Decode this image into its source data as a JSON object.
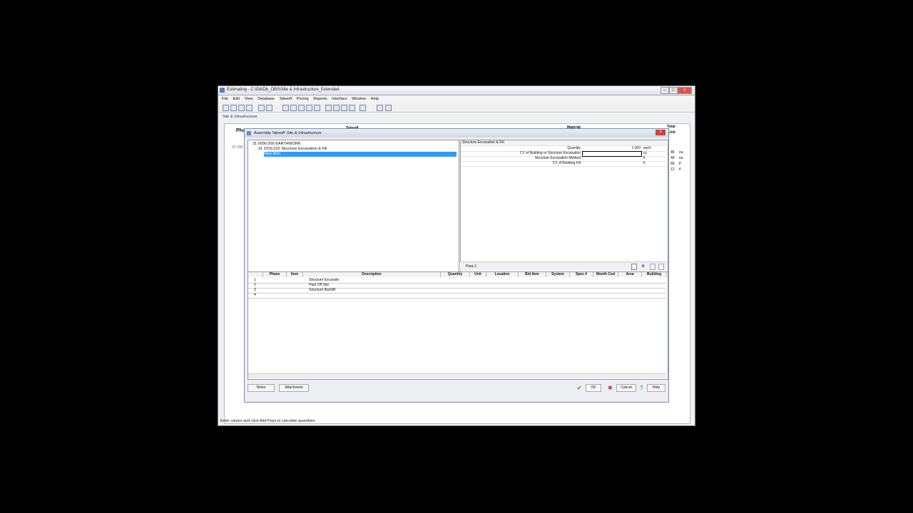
{
  "app": {
    "title": "Estimating - C:\\Db\\Db_OBS\\Site & Infrastructure_Extended",
    "menu": [
      "File",
      "Edit",
      "View",
      "Database",
      "Takeoff",
      "Pricing",
      "Reports",
      "Interface",
      "Window",
      "Help"
    ],
    "doc_tab": "Site & Infrastructure",
    "status": "Enter values and click Add Pass to calculate quantities"
  },
  "background": {
    "col_phase": "Pha",
    "takeoff": "Takeoff",
    "material": "Material",
    "total": "Total",
    "unit": "nt/Unit",
    "phase_value": "31 236",
    "side_values": [
      "48",
      "48",
      "89",
      "12"
    ],
    "side_units": [
      "ea",
      "ea",
      "if",
      "if"
    ]
  },
  "dialog": {
    "title": "Assembly Takeoff: Site & Infrastructure",
    "tree": {
      "level1": "31 0000.000  EARTHWORK",
      "level2": "31 2316.022  Structure Excavation & Fill",
      "selected": "New item"
    },
    "props": {
      "heading": "Structure Excavation & Fill",
      "rows": [
        {
          "label": "Quantity",
          "value": "1.000",
          "unit": "each"
        },
        {
          "label": "CY of Building or Structure Excavation",
          "value": "",
          "unit": "cy"
        },
        {
          "label": "Structure Excavation Method",
          "value": "",
          "unit": "lt"
        },
        {
          "label": "CY of Building Fill",
          "value": "",
          "unit": "lt"
        }
      ],
      "pass": "Pass 1"
    },
    "grid": {
      "headers": [
        "Phase",
        "Item",
        "Description",
        "Quantity",
        "Unit",
        "Location",
        "Bid Item",
        "System",
        "Spec #",
        "Month Cod",
        "Area",
        "Building"
      ],
      "rows": [
        {
          "num": "1",
          "desc": "Structure Excavate"
        },
        {
          "num": "2",
          "desc": "Haul Off Site"
        },
        {
          "num": "3",
          "desc": "Structure Backfill"
        },
        {
          "num": "4",
          "desc": ""
        }
      ]
    },
    "buttons": {
      "notes": "Notes",
      "attachment": "Attachment",
      "ok": "OK",
      "cancel": "Cancel",
      "help": "Help"
    }
  }
}
